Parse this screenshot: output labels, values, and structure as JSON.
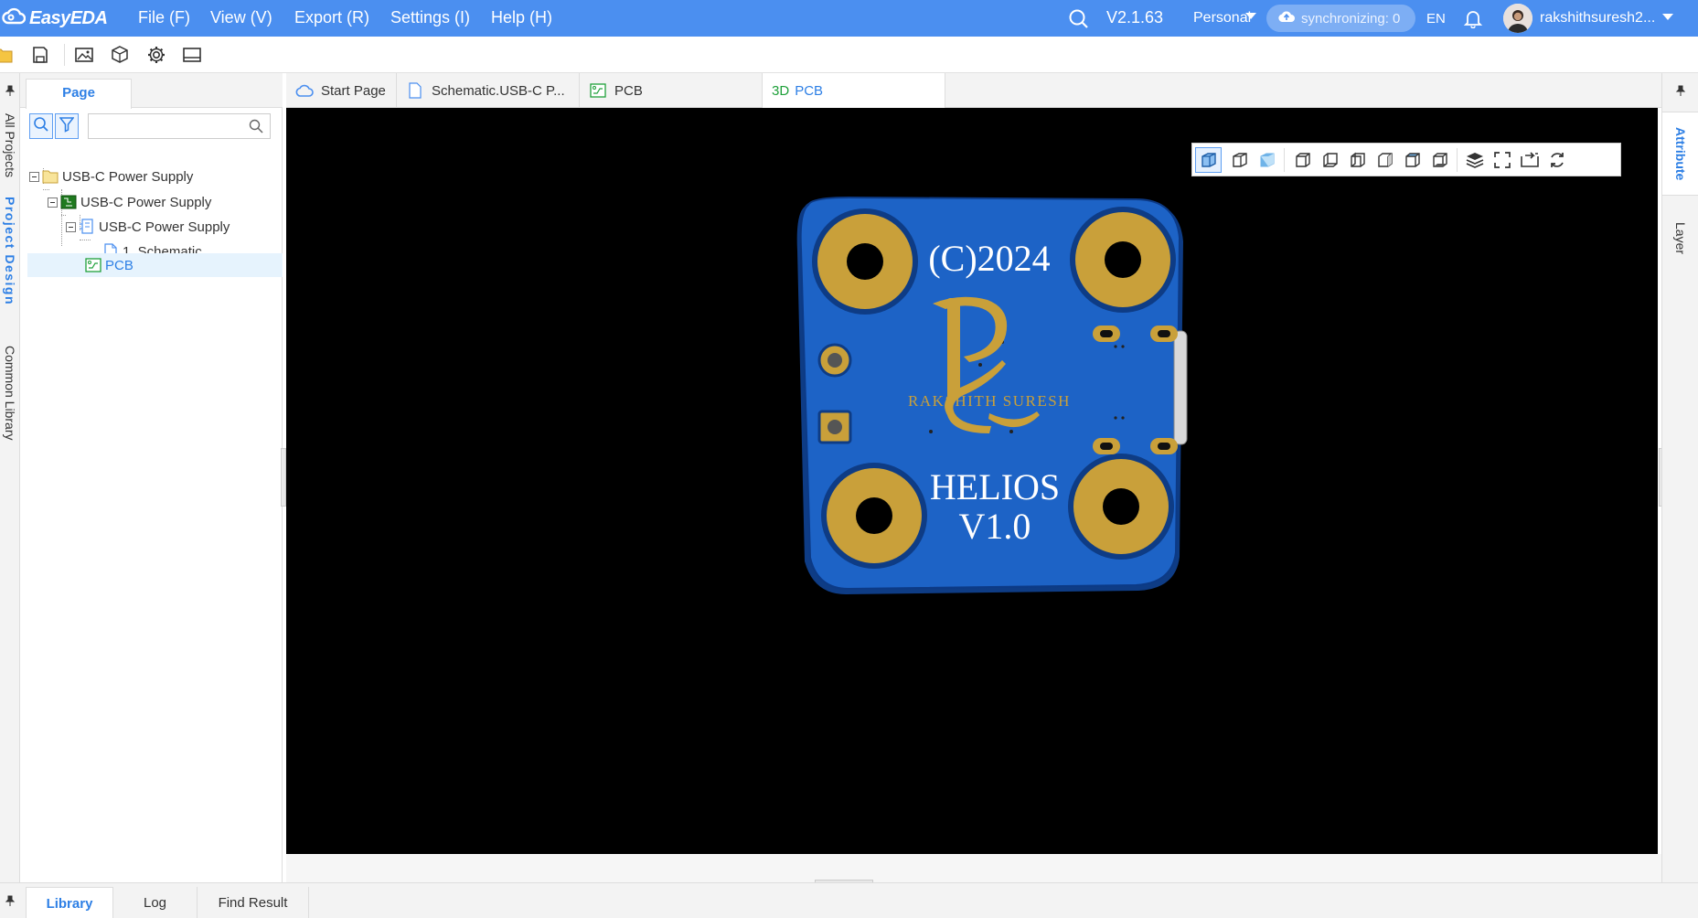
{
  "app": {
    "brand": "EasyEDA"
  },
  "menubar": {
    "items": [
      "File (F)",
      "View (V)",
      "Export (R)",
      "Settings (I)",
      "Help (H)"
    ],
    "version": "V2.1.63",
    "plan": "Personal",
    "sync_status": "synchronizing: 0",
    "language": "EN",
    "username": "rakshithsuresh2..."
  },
  "left_strip": {
    "tabs": [
      "All Projects",
      "Project Design",
      "Common Library"
    ]
  },
  "left_panel": {
    "tab": "Page",
    "search": {
      "value": "",
      "placeholder": ""
    },
    "tree": [
      {
        "label": "USB-C Power Supply",
        "level": 0,
        "type": "folder"
      },
      {
        "label": "USB-C Power Supply",
        "level": 1,
        "type": "board"
      },
      {
        "label": "USB-C Power Supply",
        "level": 2,
        "type": "schematic-set"
      },
      {
        "label": "1. Schematic",
        "level": 3,
        "type": "page"
      },
      {
        "label": "PCB",
        "level": 2,
        "type": "pcb",
        "selected": true
      }
    ]
  },
  "doc_tabs": [
    {
      "label": "Start Page",
      "icon": "cloud-icon"
    },
    {
      "label": "Schematic.USB-C P...",
      "icon": "document-icon"
    },
    {
      "label": "PCB",
      "icon": "pcb-icon"
    },
    {
      "label": "PCB",
      "prefix": "3D",
      "active": true
    }
  ],
  "pcb": {
    "copyright": "(C)2024",
    "brand_name": "RAKSHITH SURESH",
    "title": "HELIOS",
    "version": "V1.0",
    "board_color": "#1d63c6",
    "pad_color": "#c9a03a"
  },
  "right_strip": {
    "tabs": [
      "Attribute",
      "Layer"
    ]
  },
  "bottom_tabs": [
    {
      "label": "Library",
      "active": true
    },
    {
      "label": "Log"
    },
    {
      "label": "Find Result"
    }
  ],
  "colors": {
    "accent": "#4b8ff0",
    "link": "#2d7fe5"
  }
}
